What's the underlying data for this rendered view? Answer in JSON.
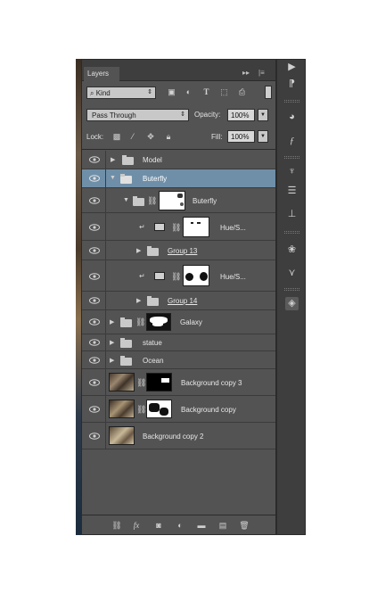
{
  "panel": {
    "tab": "Layers",
    "tab_icons": [
      "double-arrow-icon",
      "menu-icon"
    ]
  },
  "filter": {
    "kind_label": "Kind",
    "icons": [
      "image-filter-icon",
      "adjustment-filter-icon",
      "type-filter-icon",
      "shape-filter-icon",
      "smart-object-filter-icon"
    ]
  },
  "blend": {
    "mode": "Pass Through",
    "opacity_label": "Opacity:",
    "opacity_value": "100%",
    "lock_label": "Lock:",
    "fill_label": "Fill:",
    "fill_value": "100%"
  },
  "layers": [
    {
      "name": "Model",
      "type": "group",
      "indent": 0,
      "selected": false
    },
    {
      "name": "Buterfly",
      "type": "group-open",
      "indent": 0,
      "selected": true
    },
    {
      "name": "Buterfly",
      "type": "group-open-mask",
      "indent": 1,
      "selected": false
    },
    {
      "name": "Hue/S...",
      "type": "adjustment",
      "indent": 2,
      "selected": false
    },
    {
      "name": "Group 13",
      "type": "group-clipped",
      "indent": 2,
      "selected": false
    },
    {
      "name": "Hue/S...",
      "type": "adjustment",
      "indent": 2,
      "selected": false
    },
    {
      "name": "Group 14",
      "type": "group-clipped",
      "indent": 2,
      "selected": false
    },
    {
      "name": "Galaxy",
      "type": "group-mask",
      "indent": 0,
      "selected": false
    },
    {
      "name": "statue",
      "type": "group",
      "indent": 0,
      "selected": false
    },
    {
      "name": "Ocean",
      "type": "group",
      "indent": 0,
      "selected": false
    },
    {
      "name": "Background copy 3",
      "type": "pixel-mask",
      "indent": 0,
      "selected": false
    },
    {
      "name": "Background copy",
      "type": "pixel-mask",
      "indent": 0,
      "selected": false
    },
    {
      "name": "Background copy 2",
      "type": "pixel",
      "indent": 0,
      "selected": false
    }
  ],
  "footer": {
    "icons": [
      "link-layers-icon",
      "fx-icon",
      "add-mask-icon",
      "adjustment-layer-icon",
      "new-group-icon",
      "new-layer-icon",
      "trash-icon"
    ],
    "fx_label": "fx"
  },
  "dock": {
    "icons": [
      "play-icon",
      "character-paragraph-icon",
      "color-icon",
      "fx-styles-icon",
      "brush-icon",
      "adjustments-sliders-icon",
      "align-icon",
      "channels-icon",
      "paths-icon",
      "layers-icon"
    ]
  }
}
